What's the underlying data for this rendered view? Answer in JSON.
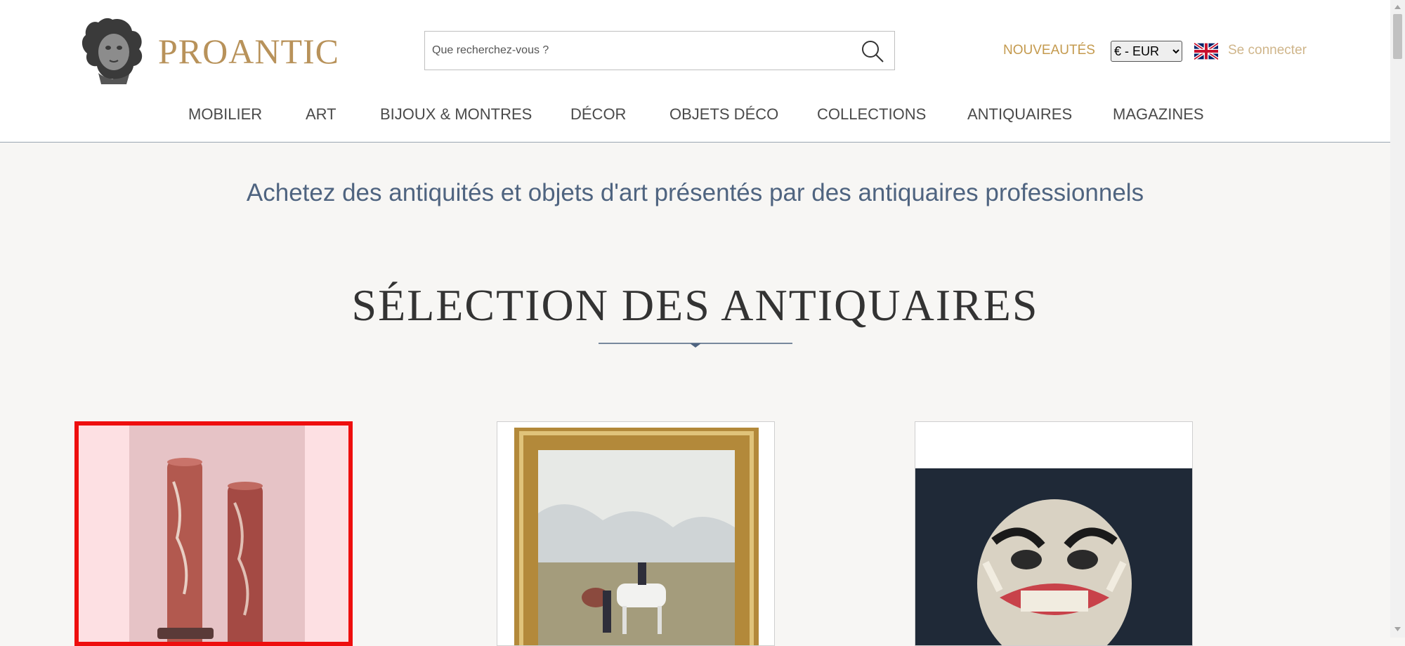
{
  "header": {
    "logo_text": "PROANTIC",
    "search": {
      "placeholder": "Que recherchez-vous ?",
      "value": ""
    },
    "nouveautes_label": "NOUVEAUTÉS",
    "currency": {
      "selected": "€ - EUR",
      "options": [
        "€ - EUR"
      ]
    },
    "language_icon": "uk-flag-icon",
    "login_label": "Se connecter"
  },
  "nav": {
    "items": [
      {
        "label": "MOBILIER"
      },
      {
        "label": "ART"
      },
      {
        "label": "BIJOUX & MONTRES"
      },
      {
        "label": "DÉCOR"
      },
      {
        "label": "OBJETS DÉCO"
      },
      {
        "label": "COLLECTIONS"
      },
      {
        "label": "ANTIQUAIRES"
      },
      {
        "label": "MAGAZINES"
      }
    ]
  },
  "main": {
    "tagline": "Achetez des antiquités et objets d'art présentés par des antiquaires professionnels",
    "section_title": "SÉLECTION DES ANTIQUAIRES"
  },
  "colors": {
    "gold": "#b8925a",
    "nav_text": "#4a4a4a",
    "tagline": "#4f6480",
    "selection_border": "#ee0e0e",
    "background": "#f7f6f4"
  }
}
